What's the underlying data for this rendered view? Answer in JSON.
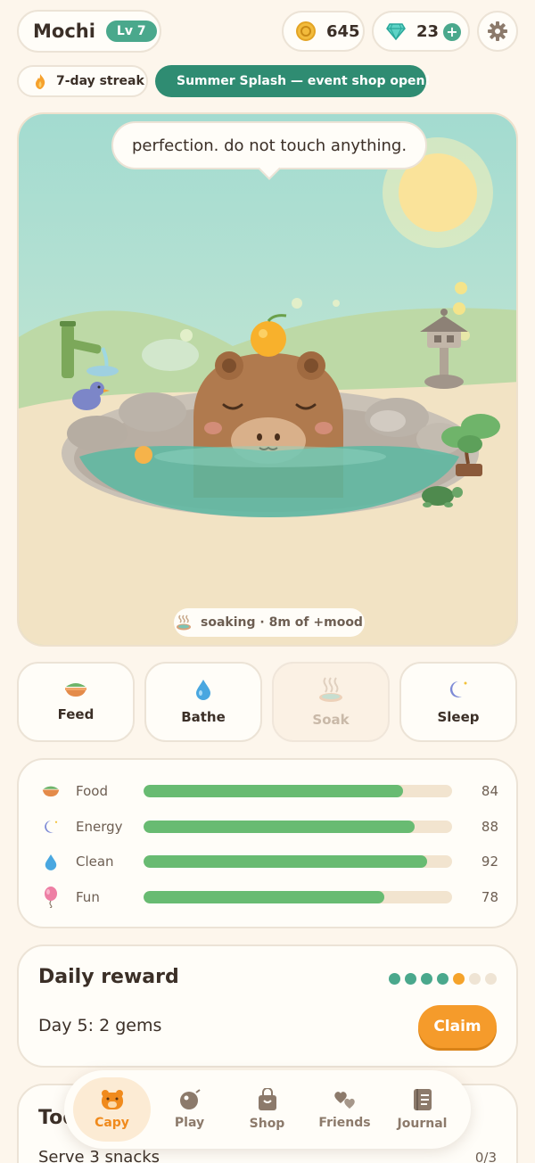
{
  "header": {
    "pet_name": "Mochi",
    "level": "Lv 7",
    "coins": "645",
    "gems": "23",
    "gem_add": "+"
  },
  "banners": {
    "streak": "7-day streak",
    "event": "Summer Splash — event shop open!"
  },
  "scene": {
    "speech": "perfection. do not touch anything.",
    "status": "soaking · 8m of +mood"
  },
  "actions": [
    {
      "label": "Feed",
      "icon": "food-bowl-icon",
      "enabled": true
    },
    {
      "label": "Bathe",
      "icon": "water-drop-icon",
      "enabled": true
    },
    {
      "label": "Soak",
      "icon": "hot-spring-icon",
      "enabled": false
    },
    {
      "label": "Sleep",
      "icon": "moon-icon",
      "enabled": true
    }
  ],
  "stats": [
    {
      "name": "Food",
      "value": "84",
      "level": 84,
      "icon": "food-bowl-icon"
    },
    {
      "name": "Energy",
      "value": "88",
      "level": 88,
      "icon": "moon-icon"
    },
    {
      "name": "Clean",
      "value": "92",
      "level": 92,
      "icon": "water-drop-icon"
    },
    {
      "name": "Fun",
      "value": "78",
      "level": 78,
      "icon": "balloon-icon"
    }
  ],
  "daily_reward": {
    "title": "Daily reward",
    "day_text": "Day 5: 2 gems",
    "claim_label": "Claim",
    "progress": {
      "claimed": 4,
      "current": 5,
      "total": 7
    }
  },
  "today": {
    "title": "Today",
    "task": "Serve 3 snacks",
    "task_progress": "0/3"
  },
  "nav": [
    {
      "label": "Capy",
      "icon": "capybara-icon",
      "active": true
    },
    {
      "label": "Play",
      "icon": "ball-icon",
      "active": false
    },
    {
      "label": "Shop",
      "icon": "shopping-bag-icon",
      "active": false
    },
    {
      "label": "Friends",
      "icon": "hearts-icon",
      "active": false
    },
    {
      "label": "Journal",
      "icon": "journal-icon",
      "active": false
    }
  ],
  "colors": {
    "background": "#fdf6ec",
    "accent_green": "#4aa88c",
    "stat_fill": "#68bb72",
    "claim_orange": "#f59b2b"
  }
}
